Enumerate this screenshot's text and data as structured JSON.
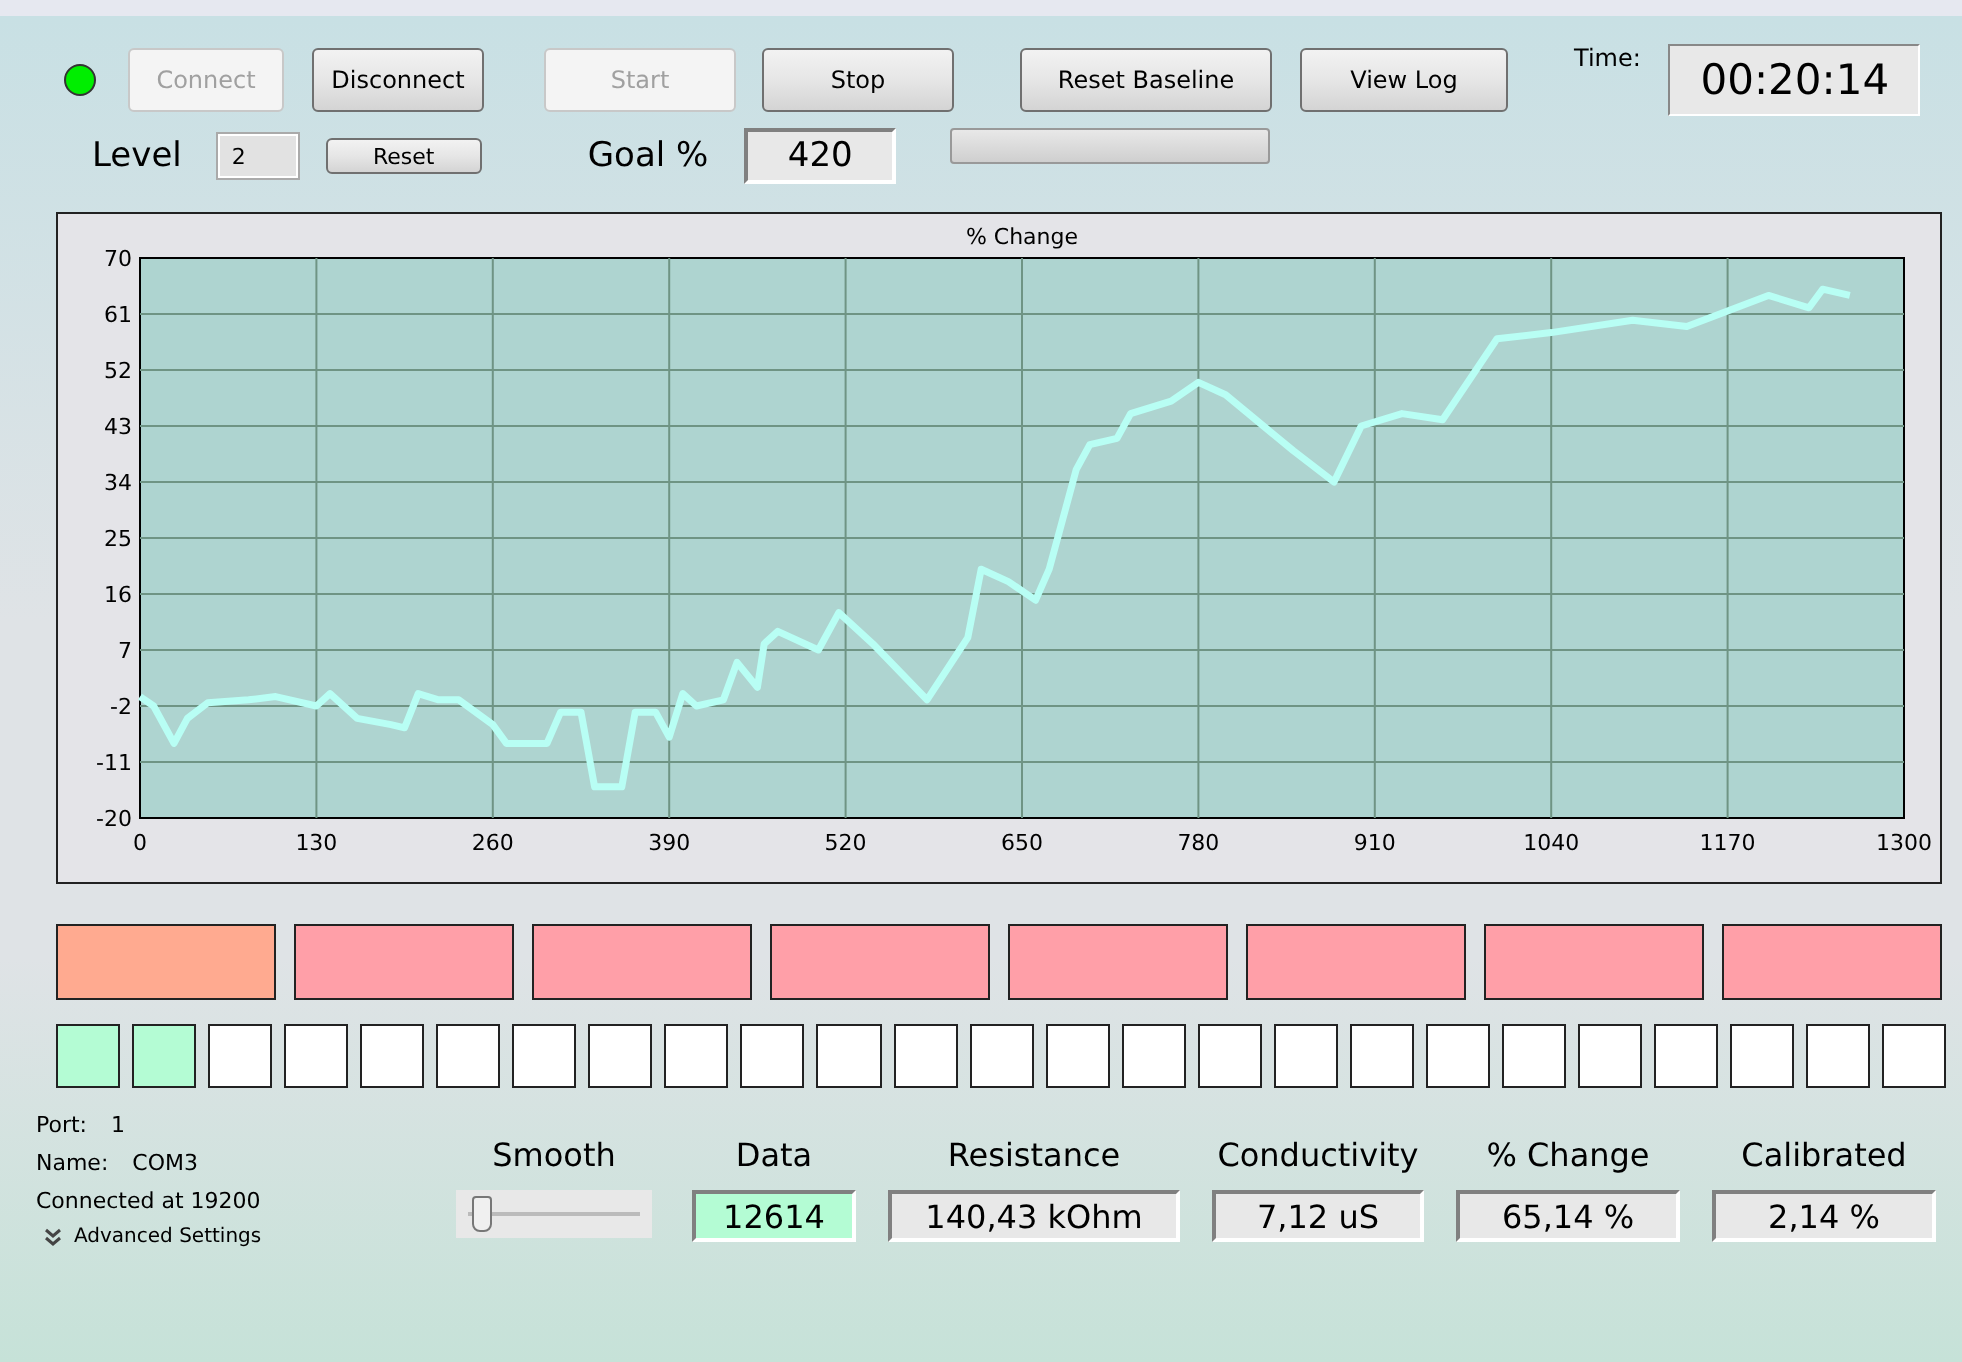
{
  "connection": {
    "connected": true
  },
  "buttons": [
    {
      "label": "Connect",
      "disabled": true
    },
    {
      "label": "Disconnect",
      "disabled": false
    },
    {
      "label": "Start",
      "disabled": true
    },
    {
      "label": "Stop",
      "disabled": false
    },
    {
      "label": "Reset Baseline",
      "disabled": false
    },
    {
      "label": "View Log",
      "disabled": false
    }
  ],
  "time": {
    "label": "Time:",
    "value": "00:20:14"
  },
  "level": {
    "label": "Level",
    "value": "2",
    "button": "Reset"
  },
  "goal": {
    "label": "Goal %",
    "value": "420",
    "progress": {
      "level": 0
    }
  },
  "chart": {
    "chart_data": {
      "type": "line",
      "title": "% Change",
      "grid": true,
      "xlim": [
        0,
        1300
      ],
      "ylim": [
        -20,
        70
      ],
      "xticks": [
        0,
        130,
        260,
        390,
        520,
        650,
        780,
        910,
        1040,
        1170,
        1300
      ],
      "yticks": [
        -20,
        -11,
        -2,
        7,
        16,
        25,
        34,
        43,
        52,
        61,
        70
      ],
      "x": [
        0,
        10,
        25,
        35,
        50,
        80,
        100,
        130,
        140,
        160,
        185,
        195,
        205,
        220,
        235,
        260,
        270,
        290,
        300,
        310,
        325,
        335,
        355,
        365,
        380,
        390,
        400,
        410,
        430,
        440,
        455,
        460,
        470,
        500,
        515,
        540,
        580,
        610,
        620,
        640,
        660,
        670,
        690,
        700,
        720,
        730,
        760,
        780,
        800,
        850,
        880,
        900,
        930,
        960,
        1000,
        1040,
        1100,
        1140,
        1200,
        1230,
        1240,
        1260
      ],
      "series": [
        {
          "color": "#b8fef4",
          "values": [
            -0.5,
            -2,
            -8,
            -4,
            -1.5,
            -1,
            -0.5,
            -2,
            0,
            -4,
            -5,
            -5.5,
            0,
            -1,
            -1,
            -5,
            -8,
            -8,
            -8,
            -3,
            -3,
            -15,
            -15,
            -3,
            -3,
            -7,
            0,
            -2,
            -1,
            5,
            1,
            8,
            10,
            7,
            13,
            8,
            -1,
            9,
            20,
            18,
            15,
            20,
            36,
            40,
            41,
            45,
            47,
            50,
            48,
            39,
            34,
            43,
            45,
            44,
            57,
            58,
            60,
            59,
            64,
            62,
            65,
            64
          ]
        }
      ]
    }
  },
  "indicators": [
    {
      "color": "#ffaa90"
    },
    {
      "color": "#ff9fa8"
    },
    {
      "color": "#ff9fa8"
    },
    {
      "color": "#ff9fa8"
    },
    {
      "color": "#ff9fa8"
    },
    {
      "color": "#ff9fa8"
    },
    {
      "color": "#ff9fa8"
    },
    {
      "color": "#ff9fa8"
    }
  ],
  "cells": [
    {
      "color": "#b4fcd4"
    },
    {
      "color": "#b4fcd4"
    },
    {
      "color": "#ffffff"
    },
    {
      "color": "#ffffff"
    },
    {
      "color": "#ffffff"
    },
    {
      "color": "#ffffff"
    },
    {
      "color": "#ffffff"
    },
    {
      "color": "#ffffff"
    },
    {
      "color": "#ffffff"
    },
    {
      "color": "#ffffff"
    },
    {
      "color": "#ffffff"
    },
    {
      "color": "#ffffff"
    },
    {
      "color": "#ffffff"
    },
    {
      "color": "#ffffff"
    },
    {
      "color": "#ffffff"
    },
    {
      "color": "#ffffff"
    },
    {
      "color": "#ffffff"
    },
    {
      "color": "#ffffff"
    },
    {
      "color": "#ffffff"
    },
    {
      "color": "#ffffff"
    },
    {
      "color": "#ffffff"
    },
    {
      "color": "#ffffff"
    },
    {
      "color": "#ffffff"
    },
    {
      "color": "#ffffff"
    },
    {
      "color": "#ffffff"
    }
  ],
  "port_info": [
    {
      "label": "Port:",
      "value": "1"
    },
    {
      "label": "Name:",
      "value": "COM3"
    }
  ],
  "connected_text": "Connected at 19200",
  "advanced_settings": "Advanced Settings",
  "smooth": {
    "label": "Smooth",
    "level": 0.05
  },
  "readouts": [
    {
      "label": "Data",
      "value": "12614",
      "highlight": true
    },
    {
      "label": "Resistance",
      "value": "140,43 kOhm",
      "highlight": false
    },
    {
      "label": "Conductivity",
      "value": "7,12 uS",
      "highlight": false
    },
    {
      "label": "% Change",
      "value": "65,14 %",
      "highlight": false
    },
    {
      "label": "Calibrated",
      "value": "2,14 %",
      "highlight": false
    }
  ]
}
